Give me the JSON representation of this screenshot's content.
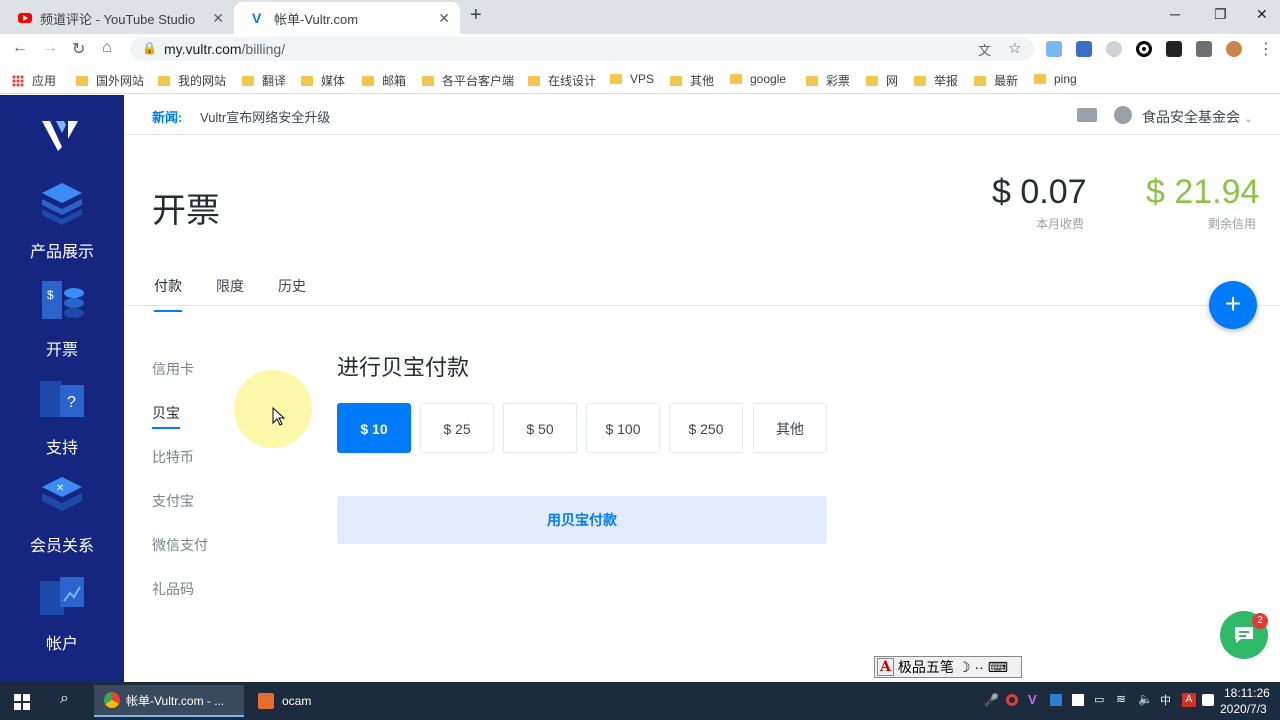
{
  "browser": {
    "tabs": [
      {
        "title": "频道评论 - YouTube Studio",
        "active": false
      },
      {
        "title": "帐单-Vultr.com",
        "active": true
      }
    ],
    "url_host": "my.vultr.com",
    "url_path": "/billing/",
    "bookmarks": [
      "应用",
      "国外网站",
      "我的网站",
      "翻译",
      "媒体",
      "邮箱",
      "各平台客户端",
      "在线设计",
      "VPS",
      "其他",
      "google",
      "彩票",
      "网",
      "举报",
      "最新",
      "ping"
    ]
  },
  "sidebar": {
    "items": [
      {
        "label": "产品展示",
        "icon": "products-icon"
      },
      {
        "label": "开票",
        "icon": "billing-icon"
      },
      {
        "label": "支持",
        "icon": "support-icon"
      },
      {
        "label": "会员关系",
        "icon": "affiliate-icon"
      },
      {
        "label": "帐户",
        "icon": "account-icon"
      }
    ]
  },
  "news": {
    "label": "新闻:",
    "text": "Vultr宣布网络安全升级"
  },
  "user": {
    "name": "食品安全基金会"
  },
  "page": {
    "title": "开票",
    "charges_value": "$ 0.07",
    "charges_label": "本月收费",
    "credit_value": "$ 21.94",
    "credit_label": "剩余信用",
    "tabs": [
      "付款",
      "限度",
      "历史"
    ],
    "active_tab": "付款"
  },
  "payment_methods": [
    "信用卡",
    "贝宝",
    "比特币",
    "支付宝",
    "微信支付",
    "礼品码"
  ],
  "active_method": "贝宝",
  "paypal": {
    "title": "进行贝宝付款",
    "amounts": [
      "$ 10",
      "$ 25",
      "$ 50",
      "$ 100",
      "$ 250",
      "其他"
    ],
    "selected": "$ 10",
    "button": "用贝宝付款"
  },
  "chat": {
    "badge": "2"
  },
  "ime": {
    "text": "极品五笔"
  },
  "taskbar": {
    "tasks": [
      "帐单-Vultr.com - ...",
      "ocam"
    ],
    "time": "18:11:26",
    "date": "2020/7/3"
  },
  "colors": {
    "accent": "#007bfc",
    "sidebar": "#142680",
    "credit": "#8bc34a"
  }
}
